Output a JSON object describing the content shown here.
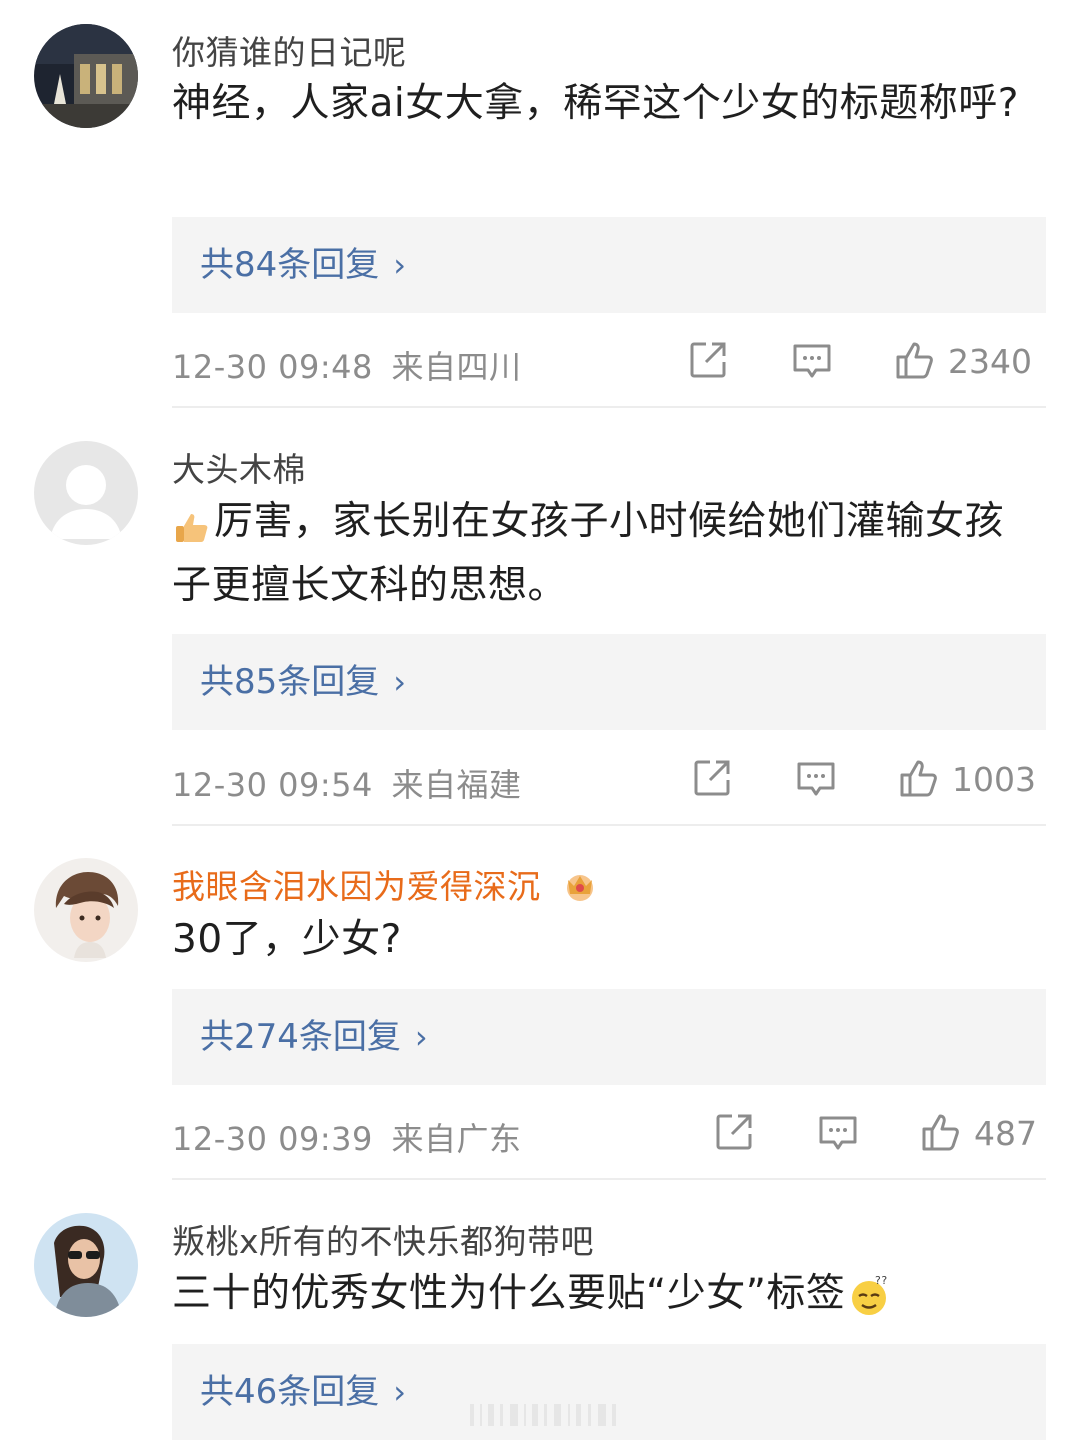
{
  "comments": [
    {
      "username": "你猜谁的日记呢",
      "text": "神经，人家ai女大拿，稀罕这个少女的标题称呼?",
      "reply_label": "共84条回复",
      "time": "12-30 09:48",
      "location": "来自四川",
      "likes": "2340",
      "avatar_icon": "night-building-photo-avatar"
    },
    {
      "username": "大头木棉",
      "text_emoji": "thumbs-up-emoji",
      "text": "厉害，家长别在女孩子小时候给她们灌输女孩子更擅长文科的思想。",
      "reply_label": "共85条回复",
      "time": "12-30 09:54",
      "location": "来自福建",
      "likes": "1003",
      "avatar_icon": "default-user-avatar"
    },
    {
      "username": "我眼含泪水因为爱得深沉",
      "username_badge": "crown-badge-icon",
      "text": "30了，少女?",
      "reply_label": "共274条回复",
      "time": "12-30 09:39",
      "location": "来自广东",
      "likes": "487",
      "avatar_icon": "anime-boy-avatar"
    },
    {
      "username": "叛桃x所有的不快乐都狗带吧",
      "text": "三十的优秀女性为什么要贴“少女”标签",
      "text_emoji": "thinking-face-emoji",
      "reply_label": "共46条回复",
      "avatar_icon": "woman-sunglasses-avatar"
    }
  ],
  "colors": {
    "link": "#4a6fa5",
    "vip_name": "#e86b1a",
    "meta": "#8c8c8c",
    "reply_bg": "#f4f4f4"
  }
}
